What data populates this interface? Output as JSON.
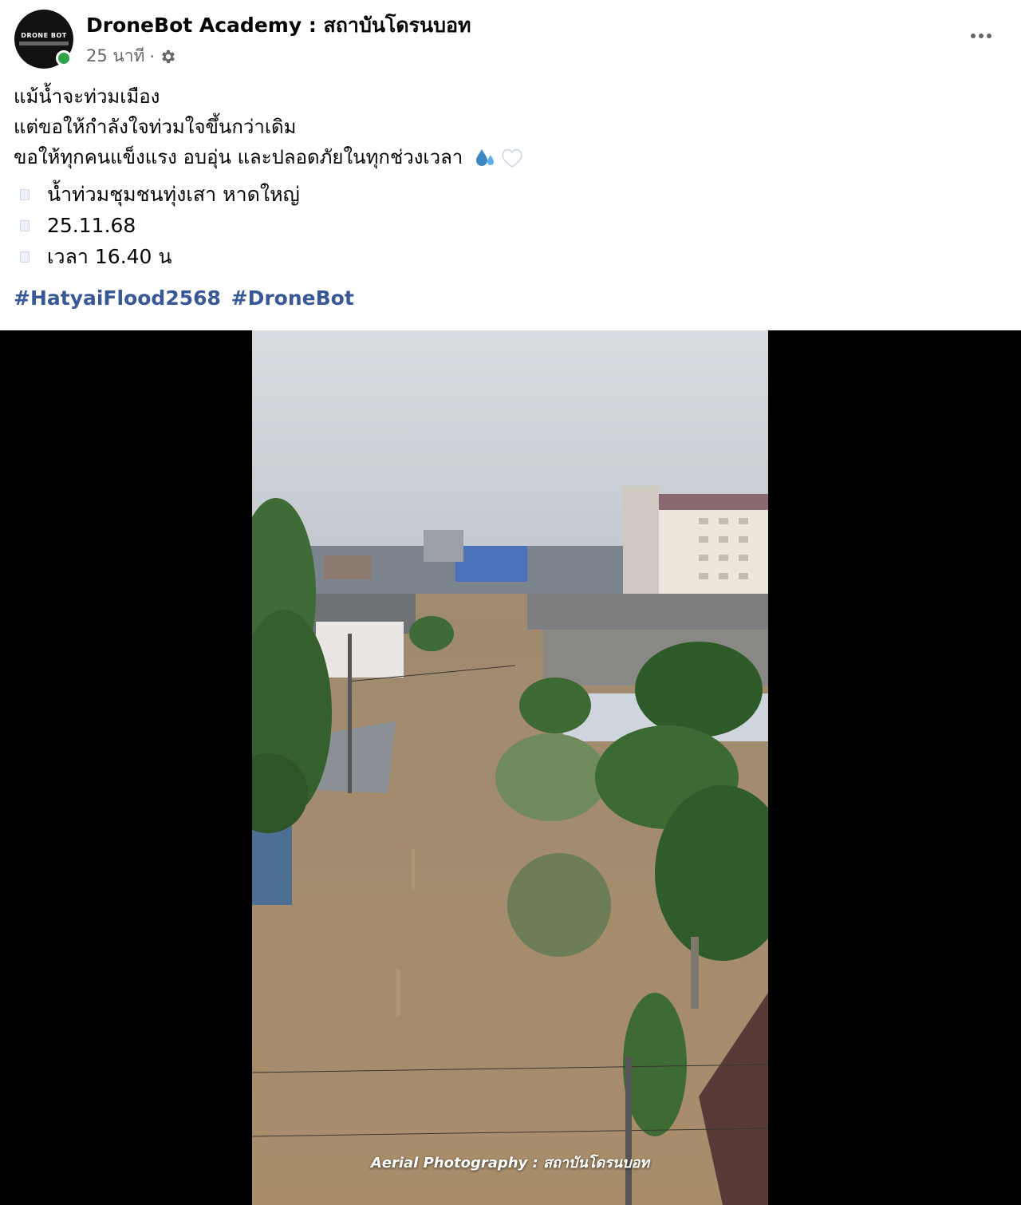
{
  "post": {
    "page_name": "DroneBot Academy : สถาบันโดรนบอท",
    "avatar_text": "DRONE BOT",
    "time": "25 นาที",
    "separator": "·",
    "privacy_icon": "gear-icon",
    "more_icon": "more-options-icon"
  },
  "body": {
    "lines": [
      "แม้น้ำจะท่วมเมือง",
      "แต่ขอให้กำลังใจท่วมใจขึ้นกว่าเดิม",
      "ขอให้ทุกคนแข็งแรง อบอุ่น และปลอดภัยในทุกช่วงเวลา"
    ],
    "emojis": [
      "droplets-emoji",
      "white-heart-emoji"
    ],
    "bullets": [
      "น้ำท่วมชุมชนทุ่งเสา หาดใหญ่",
      "25.11.68",
      "เวลา 16.40 น"
    ],
    "hashtags": [
      "#HatyaiFlood2568",
      "#DroneBot"
    ]
  },
  "video": {
    "caption": "Aerial Photography : สถาบันโดรนบอท"
  },
  "colors": {
    "hashtag": "#385898",
    "online": "#31a24c",
    "secondary_text": "#65676b"
  }
}
